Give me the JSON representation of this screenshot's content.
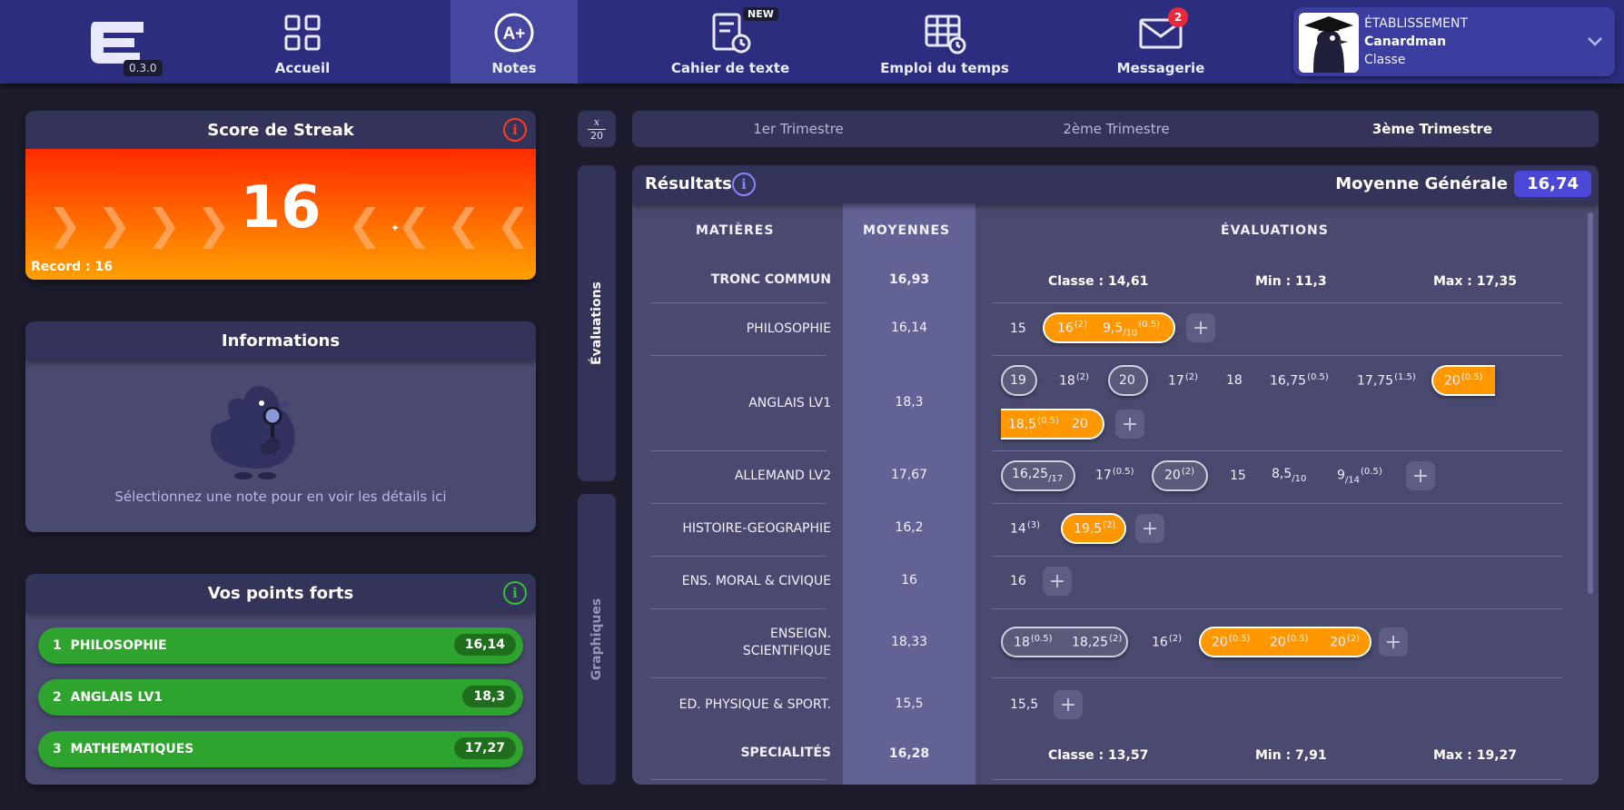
{
  "app": {
    "version": "0.3.0"
  },
  "nav": {
    "accueil": "Accueil",
    "notes": "Notes",
    "cahier": "Cahier de texte",
    "cahier_badge": "NEW",
    "emploi": "Emploi du temps",
    "messagerie": "Messagerie",
    "messagerie_badge": "2"
  },
  "etablissement": {
    "label": "ÉTABLISSEMENT",
    "name": "Canardman",
    "classe": "Classe"
  },
  "streak": {
    "title": "Score de Streak",
    "value": "16",
    "record": "Record : 16"
  },
  "informations": {
    "title": "Informations",
    "text": "Sélectionnez une note pour en voir les détails ici"
  },
  "points_forts": {
    "title": "Vos points forts",
    "items": [
      {
        "rank": "1",
        "label": "PHILOSOPHIE",
        "value": "16,14"
      },
      {
        "rank": "2",
        "label": "ANGLAIS LV1",
        "value": "18,3"
      },
      {
        "rank": "3",
        "label": "MATHEMATIQUES",
        "value": "17,27"
      }
    ]
  },
  "fraction": {
    "num": "x",
    "den": "20"
  },
  "side_tabs": {
    "evaluations": "Évaluations",
    "graphiques": "Graphiques"
  },
  "trimestres": [
    "1er Trimestre",
    "2ème Trimestre",
    "3ème Trimestre"
  ],
  "results": {
    "title": "Résultats",
    "moyenne_label": "Moyenne Générale",
    "moyenne_value": "16,74",
    "headers": {
      "matieres": "MATIÈRES",
      "moyennes": "MOYENNES",
      "evaluations": "ÉVALUATIONS"
    },
    "tronc": {
      "label": "TRONC COMMUN",
      "avg": "16,93",
      "classe": "Classe : 14,61",
      "min": "Min : 11,3",
      "max": "Max : 17,35"
    },
    "specialites": {
      "label": "SPECIALITÉS",
      "avg": "16,28",
      "classe": "Classe : 13,57",
      "min": "Min : 7,91",
      "max": "Max : 19,27"
    },
    "subjects": [
      {
        "name": "PHILOSOPHIE",
        "avg": "16,14"
      },
      {
        "name": "ANGLAIS LV1",
        "avg": "18,3"
      },
      {
        "name": "ALLEMAND LV2",
        "avg": "17,67"
      },
      {
        "name": "HISTOIRE-GEOGRAPHIE",
        "avg": "16,2"
      },
      {
        "name": "ENS. MORAL & CIVIQUE",
        "avg": "16"
      },
      {
        "name_l1": "ENSEIGN.",
        "name_l2": "SCIENTIFIQUE",
        "avg": "18,33"
      },
      {
        "name": "ED. PHYSIQUE & SPORT.",
        "avg": "15,5"
      }
    ],
    "grades": {
      "philo": [
        "15",
        "16",
        "(2)",
        "9,5",
        "/10",
        "(0.5)"
      ],
      "anglais": [
        "19",
        "18",
        "(2)",
        "20",
        "17",
        "(2)",
        "18",
        "16,75",
        "(0.5)",
        "17,75",
        "(1.5)",
        "20",
        "(0.5)",
        "18,5",
        "(0.5)",
        "20"
      ],
      "allemand": [
        "16,25",
        "/17",
        "17",
        "(0.5)",
        "20",
        "(2)",
        "15",
        "8,5",
        "/10",
        "9",
        "/14",
        "(0.5)"
      ],
      "histoire": [
        "14",
        "(3)",
        "19,5",
        "(2)"
      ],
      "emc": [
        "16"
      ],
      "scient": [
        "18",
        "(0.5)",
        "18,25",
        "(2)",
        "16",
        "(2)",
        "20",
        "(0.5)",
        "20",
        "(0.5)",
        "20",
        "(2)"
      ],
      "eps": [
        "15,5"
      ]
    },
    "add_label": "+"
  },
  "colors": {
    "accent": "#4b48d8",
    "streak_orange": "#ff9800",
    "strength_green": "#2ea42e",
    "topbar": "#2d2d80"
  }
}
